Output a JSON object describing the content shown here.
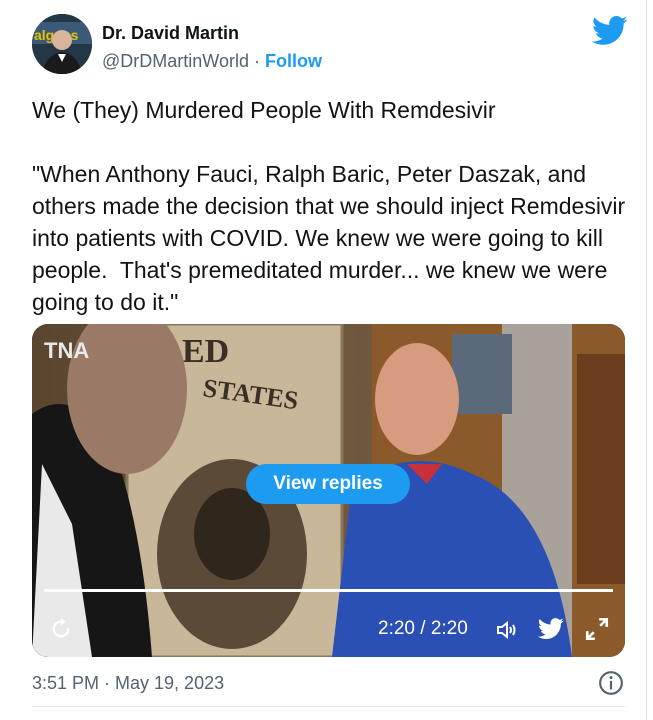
{
  "author": {
    "name": "Dr. David Martin",
    "handle": "@DrDMartinWorld",
    "separator": "·",
    "follow_label": "Follow",
    "avatar_text": "algens"
  },
  "tweet": {
    "title": "We (They) Murdered People With Remdesivir",
    "quote": "\"When Anthony Fauci, Ralph Baric, Peter Daszak, and others made the decision that we should inject Remdesivir into patients with COVID. We knew we were going to kill people.  That's premeditated murder... we knew we were going to do it.\""
  },
  "media": {
    "watermark": "TNA",
    "banknote_text_top": "ED",
    "banknote_text": "STATES",
    "view_replies_label": "View replies",
    "time_display": "2:20 / 2:20",
    "progress": 1.0
  },
  "footer": {
    "timestamp": "3:51 PM · May 19, 2023"
  },
  "icons": {
    "brand": "twitter-bird-icon",
    "replay": "replay-icon",
    "volume": "volume-icon",
    "share": "twitter-share-icon",
    "fullscreen": "fullscreen-icon",
    "info": "info-icon"
  },
  "colors": {
    "accent": "#1d9bf0",
    "text": "#0f1419",
    "secondary": "#536471"
  }
}
